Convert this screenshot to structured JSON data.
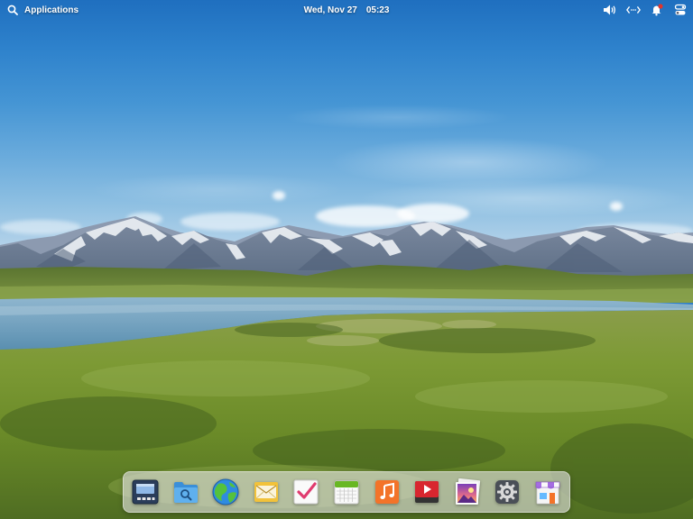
{
  "panel": {
    "applications_label": "Applications",
    "date": "Wed, Nov 27",
    "time": "05:23",
    "indicators": [
      {
        "name": "volume",
        "icon": "speaker-volume-icon"
      },
      {
        "name": "network",
        "icon": "network-wired-icon"
      },
      {
        "name": "notifications",
        "icon": "bell-icon",
        "badge": true,
        "badge_color": "#e0342b"
      },
      {
        "name": "session",
        "icon": "session-toggle-icon"
      }
    ]
  },
  "wallpaper": {
    "description": "Mountain range with snow caps, lake and green meadow under blue sky",
    "colors": {
      "sky_top": "#1f6fbf",
      "sky_horizon": "#cfe0ee",
      "mountain": "#6e7f97",
      "snow": "#eef2f6",
      "lake": "#6d9dbb",
      "meadow": "#6f8f2c"
    }
  },
  "dock": {
    "items": [
      {
        "name": "multitasking-view",
        "label": "Multitasking View",
        "icon": "multitasking-icon"
      },
      {
        "name": "files",
        "label": "Files",
        "icon": "folder-search-icon"
      },
      {
        "name": "web-browser",
        "label": "Web",
        "icon": "globe-icon"
      },
      {
        "name": "mail",
        "label": "Mail",
        "icon": "envelope-icon"
      },
      {
        "name": "tasks",
        "label": "Tasks",
        "icon": "checkmark-icon"
      },
      {
        "name": "calendar",
        "label": "Calendar",
        "icon": "calendar-icon"
      },
      {
        "name": "music",
        "label": "Music",
        "icon": "music-note-icon"
      },
      {
        "name": "videos",
        "label": "Videos",
        "icon": "play-icon"
      },
      {
        "name": "photos",
        "label": "Photos",
        "icon": "photos-icon"
      },
      {
        "name": "system-settings",
        "label": "System Settings",
        "icon": "gear-icon"
      },
      {
        "name": "appcenter",
        "label": "AppCenter",
        "icon": "store-icon"
      }
    ]
  }
}
